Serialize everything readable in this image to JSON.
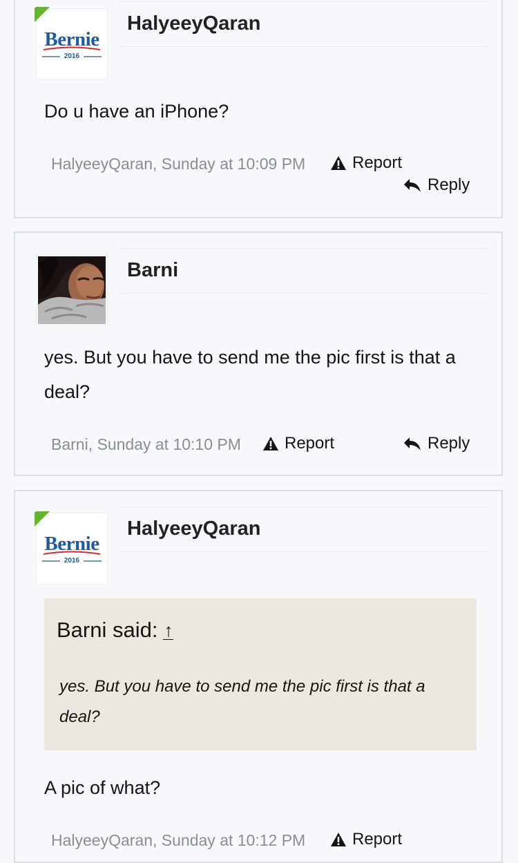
{
  "posts": [
    {
      "username": "HalyeeyQaran",
      "avatar": {
        "type": "logo",
        "text": "Bernie",
        "year": "2016"
      },
      "message": "Do u have an iPhone?",
      "meta": "HalyeeyQaran, Sunday at 10:09 PM",
      "report_label": "Report",
      "reply_label": "Reply"
    },
    {
      "username": "Barni",
      "avatar": {
        "type": "photo"
      },
      "message": "yes. But you have to send me the pic first is that a deal?",
      "meta": "Barni, Sunday at 10:10 PM",
      "report_label": "Report",
      "reply_label": "Reply"
    },
    {
      "username": "HalyeeyQaran",
      "avatar": {
        "type": "logo",
        "text": "Bernie",
        "year": "2016"
      },
      "quote": {
        "header": "Barni said:",
        "arrow": "↑",
        "body": "yes. But you have to send me the pic first is that a deal?"
      },
      "message": "A pic of what?",
      "meta": "HalyeeyQaran, Sunday at 10:12 PM",
      "report_label": "Report"
    }
  ],
  "colors": {
    "background": "#f7f8fc",
    "border": "#dcdee6",
    "logo_blue": "#1f5aa3",
    "logo_red": "#d8262f",
    "staff_green": "#65b32e",
    "quote_bg": "#ebe9df",
    "meta_gray": "#8b8d94"
  },
  "icons": [
    "warning-icon",
    "reply-arrow-icon",
    "quote-jump-arrow-icon"
  ]
}
